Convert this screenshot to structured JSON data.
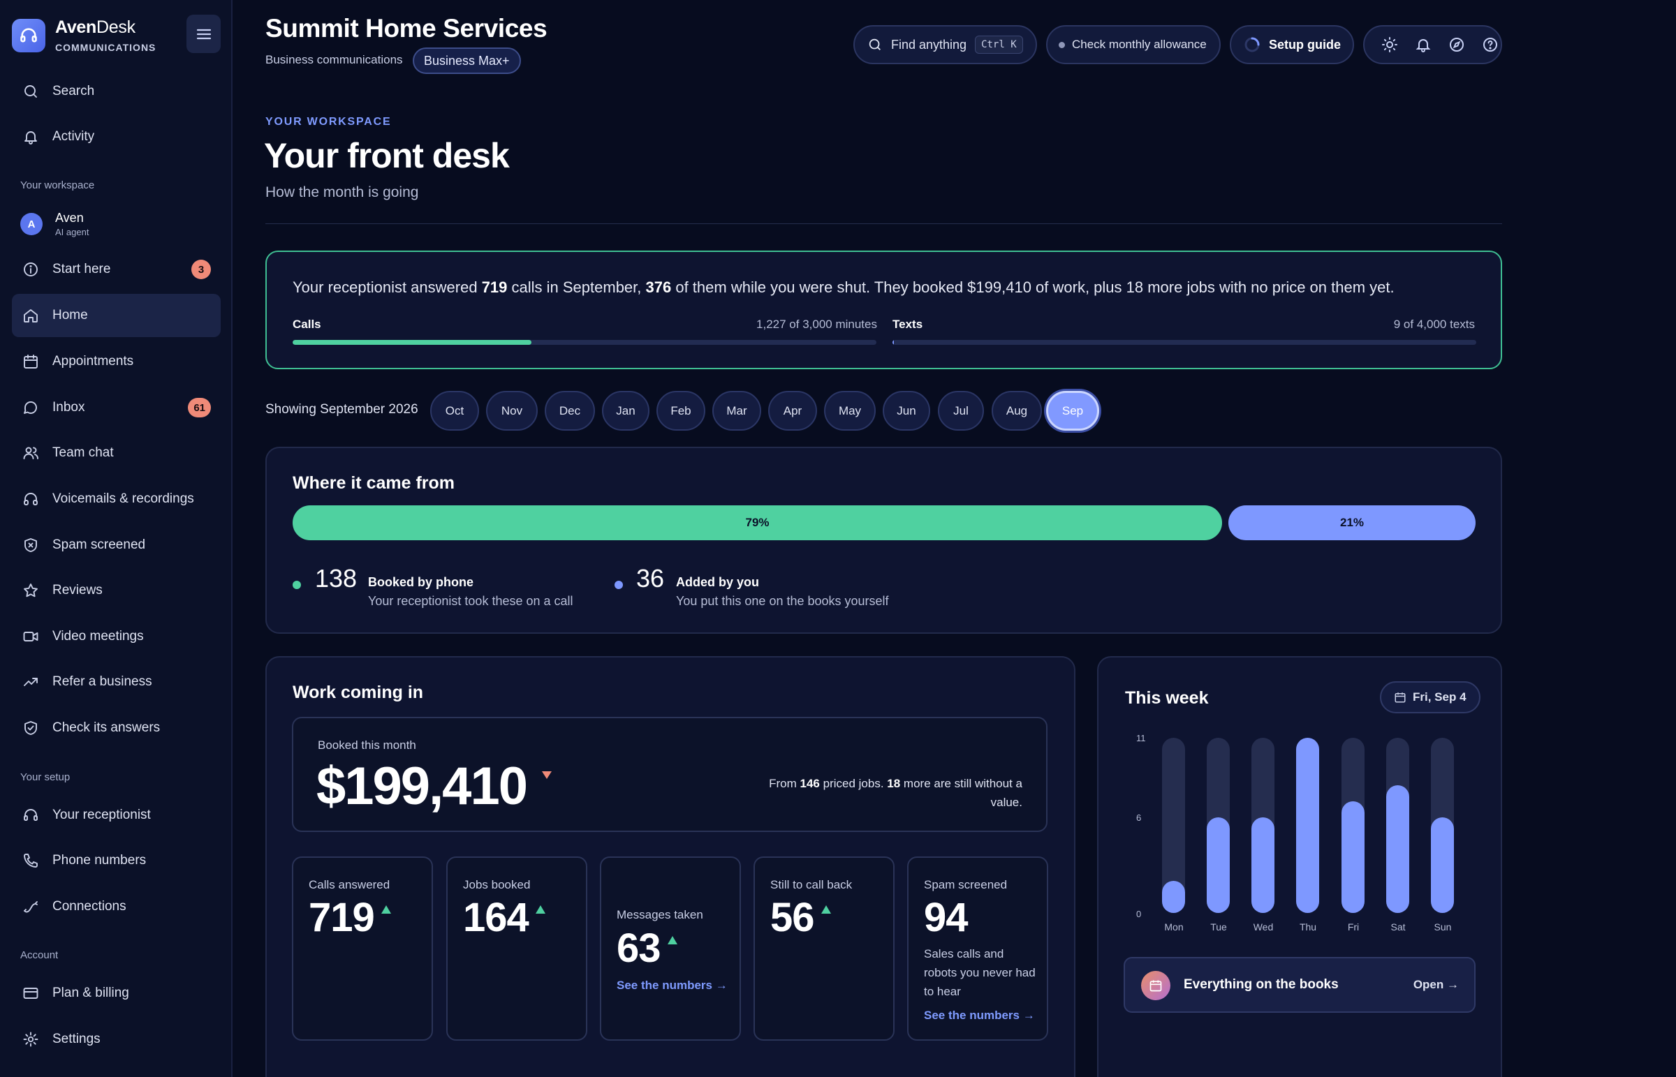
{
  "brand": {
    "name_bold": "Aven",
    "name_light": "Desk",
    "subtitle": "COMMUNICATIONS"
  },
  "sidebar": {
    "top_items": [
      {
        "label": "Search",
        "icon": "search-icon"
      },
      {
        "label": "Activity",
        "icon": "bell-icon"
      }
    ],
    "section_workspace": "Your workspace",
    "agent": {
      "initial": "A",
      "name": "Aven",
      "role": "AI agent"
    },
    "workspace_items": [
      {
        "label": "Start here",
        "icon": "info-icon",
        "badge": "3"
      },
      {
        "label": "Home",
        "icon": "home-icon",
        "active": true
      },
      {
        "label": "Appointments",
        "icon": "calendar-icon"
      },
      {
        "label": "Inbox",
        "icon": "chat-icon",
        "badge": "61"
      },
      {
        "label": "Team chat",
        "icon": "users-icon"
      },
      {
        "label": "Voicemails & recordings",
        "icon": "headphones-icon"
      },
      {
        "label": "Spam screened",
        "icon": "shield-x-icon"
      },
      {
        "label": "Reviews",
        "icon": "star-icon"
      },
      {
        "label": "Video meetings",
        "icon": "video-icon"
      },
      {
        "label": "Refer a business",
        "icon": "trending-up-icon"
      },
      {
        "label": "Check its answers",
        "icon": "shield-check-icon"
      }
    ],
    "section_setup": "Your setup",
    "setup_items": [
      {
        "label": "Your receptionist",
        "icon": "headset-icon"
      },
      {
        "label": "Phone numbers",
        "icon": "phone-icon"
      },
      {
        "label": "Connections",
        "icon": "link-icon"
      }
    ],
    "section_account": "Account",
    "account_items": [
      {
        "label": "Plan & billing",
        "icon": "credit-card-icon"
      },
      {
        "label": "Settings",
        "icon": "gear-icon"
      }
    ]
  },
  "header": {
    "title": "Summit Home Services",
    "subtitle": "Business communications",
    "plan": "Business Max+",
    "search_label": "Find anything",
    "search_shortcut": "Ctrl K",
    "allowance_label": "Check monthly allowance",
    "setup_label": "Setup guide"
  },
  "hero": {
    "eyebrow": "YOUR WORKSPACE",
    "title": "Your front desk",
    "subtitle": "How the month is going"
  },
  "summary": {
    "p1": "Your receptionist answered ",
    "calls_count": "719",
    "p2": " calls in September, ",
    "after_hours": "376",
    "p3": " of them while you were shut. They booked $199,410 of work, plus 18 more jobs with no price on them yet.",
    "calls_label": "Calls",
    "calls_usage": "1,227 of 3,000 minutes",
    "calls_fraction": 0.409,
    "texts_label": "Texts",
    "texts_usage": "9 of 4,000 texts",
    "texts_fraction": 0.00225
  },
  "months": {
    "label": "Showing September 2026",
    "items": [
      "Oct",
      "Nov",
      "Dec",
      "Jan",
      "Feb",
      "Mar",
      "Apr",
      "May",
      "Jun",
      "Jul",
      "Aug",
      "Sep"
    ],
    "selected": "Sep"
  },
  "sources": {
    "title": "Where it came from",
    "phone_percent": "79%",
    "phone_fraction": 0.79,
    "manual_percent": "21%",
    "manual_fraction": 0.21,
    "phone_count": "138",
    "phone_name": "Booked by phone",
    "phone_desc": "Your receptionist took these on a call",
    "manual_count": "36",
    "manual_name": "Added by you",
    "manual_desc": "You put this one on the books yourself",
    "phone_color": "#4fd1a0",
    "manual_color": "#7e98ff"
  },
  "work": {
    "title": "Work coming in",
    "booked_label": "Booked this month",
    "booked_value": "$199,410",
    "note_p1": "From ",
    "note_priced": "146",
    "note_p2": " priced jobs. ",
    "note_unpriced": "18",
    "note_p3": " more are still without a value.",
    "stats": [
      {
        "label": "Calls answered",
        "value": "719",
        "trend": "up"
      },
      {
        "label": "Jobs booked",
        "value": "164",
        "trend": "up"
      },
      {
        "label": "Messages taken",
        "value": "63",
        "trend": "up",
        "link": "See the numbers →"
      },
      {
        "label": "Still to call back",
        "value": "56",
        "trend": "up"
      },
      {
        "label": "Spam screened",
        "value": "94",
        "desc": "Sales calls and robots you never had to hear",
        "link": "See the numbers →"
      }
    ]
  },
  "week": {
    "title": "This week",
    "date": "Fri, Sep 4",
    "ticks": [
      "11",
      "6",
      "0"
    ],
    "max": 11,
    "chart_data": {
      "type": "bar",
      "categories": [
        "Mon",
        "Tue",
        "Wed",
        "Thu",
        "Fri",
        "Sat",
        "Sun"
      ],
      "values": [
        2,
        6,
        6,
        11,
        7,
        8,
        6
      ],
      "ylim": [
        0,
        11
      ]
    },
    "books_label": "Everything on the books",
    "books_action": "Open →"
  },
  "colors": {
    "accent": "#7e98ff",
    "success": "#4fd1a0",
    "alert": "#f08a78"
  }
}
